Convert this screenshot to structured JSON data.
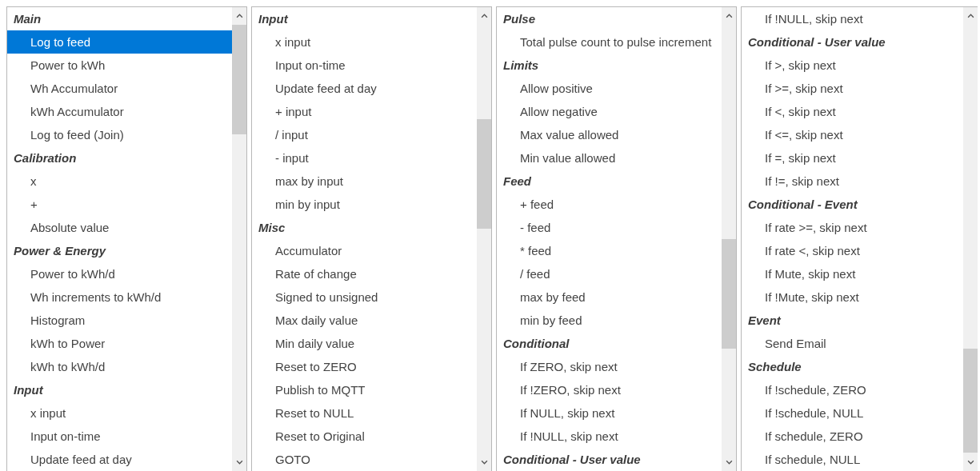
{
  "lists": [
    {
      "items": [
        {
          "kind": "header",
          "label": "Main",
          "selected": false
        },
        {
          "kind": "item",
          "label": "Log to feed",
          "selected": true
        },
        {
          "kind": "item",
          "label": "Power to kWh",
          "selected": false
        },
        {
          "kind": "item",
          "label": "Wh Accumulator",
          "selected": false
        },
        {
          "kind": "item",
          "label": "kWh Accumulator",
          "selected": false
        },
        {
          "kind": "item",
          "label": "Log to feed (Join)",
          "selected": false
        },
        {
          "kind": "header",
          "label": "Calibration",
          "selected": false
        },
        {
          "kind": "item",
          "label": "x",
          "selected": false
        },
        {
          "kind": "item",
          "label": "+",
          "selected": false
        },
        {
          "kind": "item",
          "label": "Absolute value",
          "selected": false
        },
        {
          "kind": "header",
          "label": "Power & Energy",
          "selected": false
        },
        {
          "kind": "item",
          "label": "Power to kWh/d",
          "selected": false
        },
        {
          "kind": "item",
          "label": "Wh increments to kWh/d",
          "selected": false
        },
        {
          "kind": "item",
          "label": "Histogram",
          "selected": false
        },
        {
          "kind": "item",
          "label": "kWh to Power",
          "selected": false
        },
        {
          "kind": "item",
          "label": "kWh to kWh/d",
          "selected": false
        },
        {
          "kind": "header",
          "label": "Input",
          "selected": false
        },
        {
          "kind": "item",
          "label": "x input",
          "selected": false
        },
        {
          "kind": "item",
          "label": "Input on-time",
          "selected": false
        },
        {
          "kind": "item",
          "label": "Update feed at day",
          "selected": false
        }
      ]
    },
    {
      "items": [
        {
          "kind": "header",
          "label": "Input",
          "selected": false
        },
        {
          "kind": "item",
          "label": "x input",
          "selected": false
        },
        {
          "kind": "item",
          "label": "Input on-time",
          "selected": false
        },
        {
          "kind": "item",
          "label": "Update feed at day",
          "selected": false
        },
        {
          "kind": "item",
          "label": "+ input",
          "selected": false
        },
        {
          "kind": "item",
          "label": "/ input",
          "selected": false
        },
        {
          "kind": "item",
          "label": "- input",
          "selected": false
        },
        {
          "kind": "item",
          "label": "max by input",
          "selected": false
        },
        {
          "kind": "item",
          "label": "min by input",
          "selected": false
        },
        {
          "kind": "header",
          "label": "Misc",
          "selected": false
        },
        {
          "kind": "item",
          "label": "Accumulator",
          "selected": false
        },
        {
          "kind": "item",
          "label": "Rate of change",
          "selected": false
        },
        {
          "kind": "item",
          "label": "Signed to unsigned",
          "selected": false
        },
        {
          "kind": "item",
          "label": "Max daily value",
          "selected": false
        },
        {
          "kind": "item",
          "label": "Min daily value",
          "selected": false
        },
        {
          "kind": "item",
          "label": "Reset to ZERO",
          "selected": false
        },
        {
          "kind": "item",
          "label": "Publish to MQTT",
          "selected": false
        },
        {
          "kind": "item",
          "label": "Reset to NULL",
          "selected": false
        },
        {
          "kind": "item",
          "label": "Reset to Original",
          "selected": false
        },
        {
          "kind": "item",
          "label": "GOTO",
          "selected": false
        }
      ]
    },
    {
      "items": [
        {
          "kind": "header",
          "label": "Pulse",
          "selected": false
        },
        {
          "kind": "item",
          "label": "Total pulse count to pulse increment",
          "selected": false
        },
        {
          "kind": "header",
          "label": "Limits",
          "selected": false
        },
        {
          "kind": "item",
          "label": "Allow positive",
          "selected": false
        },
        {
          "kind": "item",
          "label": "Allow negative",
          "selected": false
        },
        {
          "kind": "item",
          "label": "Max value allowed",
          "selected": false
        },
        {
          "kind": "item",
          "label": "Min value allowed",
          "selected": false
        },
        {
          "kind": "header",
          "label": "Feed",
          "selected": false
        },
        {
          "kind": "item",
          "label": "+ feed",
          "selected": false
        },
        {
          "kind": "item",
          "label": "- feed",
          "selected": false
        },
        {
          "kind": "item",
          "label": "* feed",
          "selected": false
        },
        {
          "kind": "item",
          "label": "/ feed",
          "selected": false
        },
        {
          "kind": "item",
          "label": "max by feed",
          "selected": false
        },
        {
          "kind": "item",
          "label": "min by feed",
          "selected": false
        },
        {
          "kind": "header",
          "label": "Conditional",
          "selected": false
        },
        {
          "kind": "item",
          "label": "If ZERO, skip next",
          "selected": false
        },
        {
          "kind": "item",
          "label": "If !ZERO, skip next",
          "selected": false
        },
        {
          "kind": "item",
          "label": "If NULL, skip next",
          "selected": false
        },
        {
          "kind": "item",
          "label": "If !NULL, skip next",
          "selected": false
        },
        {
          "kind": "header",
          "label": "Conditional - User value",
          "selected": false
        }
      ]
    },
    {
      "items": [
        {
          "kind": "item",
          "label": "If !NULL, skip next",
          "selected": false
        },
        {
          "kind": "header",
          "label": "Conditional - User value",
          "selected": false
        },
        {
          "kind": "item",
          "label": "If >, skip next",
          "selected": false
        },
        {
          "kind": "item",
          "label": "If >=, skip next",
          "selected": false
        },
        {
          "kind": "item",
          "label": "If <, skip next",
          "selected": false
        },
        {
          "kind": "item",
          "label": "If <=, skip next",
          "selected": false
        },
        {
          "kind": "item",
          "label": "If =, skip next",
          "selected": false
        },
        {
          "kind": "item",
          "label": "If !=, skip next",
          "selected": false
        },
        {
          "kind": "header",
          "label": "Conditional - Event",
          "selected": false
        },
        {
          "kind": "item",
          "label": "If rate >=, skip next",
          "selected": false
        },
        {
          "kind": "item",
          "label": "If rate <, skip next",
          "selected": false
        },
        {
          "kind": "item",
          "label": "If Mute, skip next",
          "selected": false
        },
        {
          "kind": "item",
          "label": "If !Mute, skip next",
          "selected": false
        },
        {
          "kind": "header",
          "label": "Event",
          "selected": false
        },
        {
          "kind": "item",
          "label": "Send Email",
          "selected": false
        },
        {
          "kind": "header",
          "label": "Schedule",
          "selected": false
        },
        {
          "kind": "item",
          "label": "If !schedule, ZERO",
          "selected": false
        },
        {
          "kind": "item",
          "label": "If !schedule, NULL",
          "selected": false
        },
        {
          "kind": "item",
          "label": "If schedule, ZERO",
          "selected": false
        },
        {
          "kind": "item",
          "label": "If schedule, NULL",
          "selected": false
        }
      ]
    }
  ]
}
